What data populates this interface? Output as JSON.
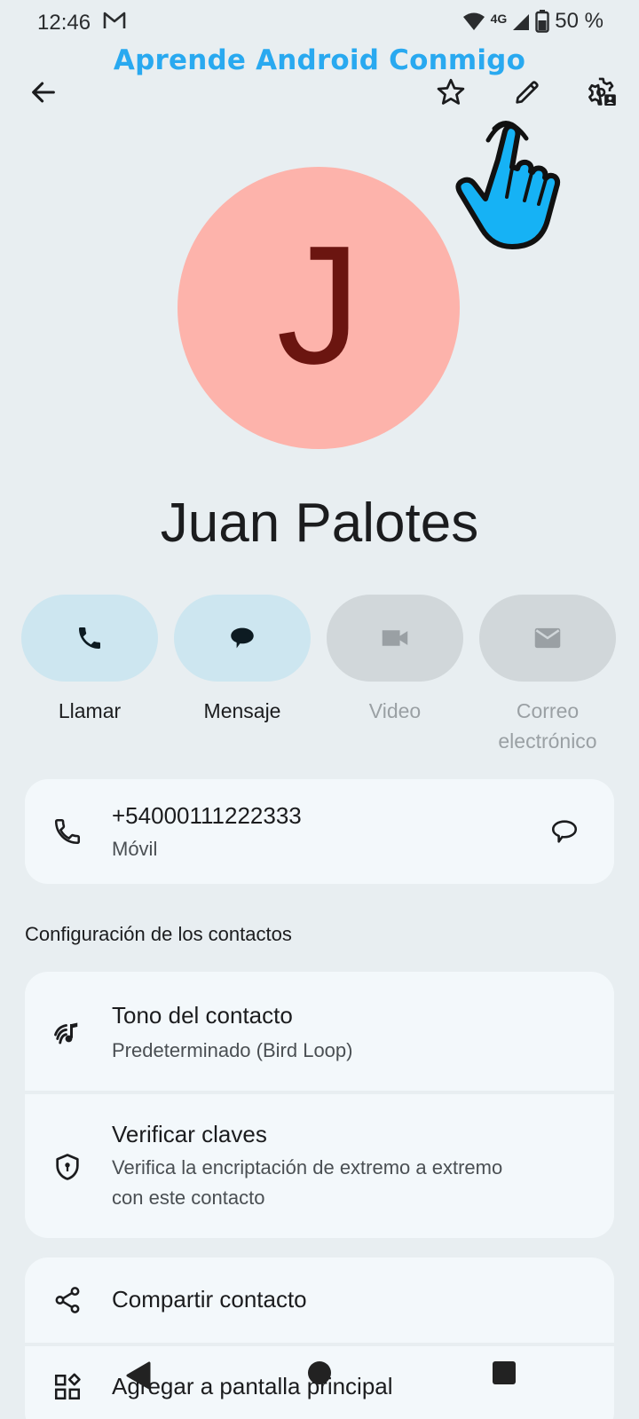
{
  "status_bar": {
    "time": "12:46",
    "network": "4G",
    "battery": "50 %"
  },
  "watermark": "Aprende Android Conmigo",
  "topbar": {
    "back_icon": "arrow-back-icon",
    "star_icon": "star-outline-icon",
    "edit_icon": "pencil-icon",
    "settings_icon": "contact-settings-icon"
  },
  "contact": {
    "initial": "J",
    "name": "Juan Palotes",
    "avatar_color": "#fdb3ab"
  },
  "actions": [
    {
      "label": "Llamar",
      "icon": "phone-icon",
      "enabled": true
    },
    {
      "label": "Mensaje",
      "icon": "message-icon",
      "enabled": true
    },
    {
      "label": "Video",
      "icon": "video-icon",
      "enabled": false
    },
    {
      "label_line1": "Correo",
      "label_line2": "electrónico",
      "icon": "mail-icon",
      "enabled": false
    }
  ],
  "phone_card": {
    "number": "+54000111222333",
    "type": "Móvil"
  },
  "settings_section": {
    "title": "Configuración de los contactos",
    "ringtone_title": "Tono del contacto",
    "ringtone_value": "Predeterminado (Bird Loop)",
    "verify_title": "Verificar claves",
    "verify_sub_line1": "Verifica la encriptación de extremo a extremo",
    "verify_sub_line2": "con este contacto"
  },
  "more_section": {
    "share_label": "Compartir contacto",
    "add_home_label": "Agregar a pantalla principal"
  },
  "colors": {
    "background": "#e8eef1",
    "card": "#f3f8fb",
    "action_active": "#cde6f0",
    "action_disabled": "#d1d7da",
    "watermark": "#29a9f0",
    "hand": "#16b2f5"
  }
}
